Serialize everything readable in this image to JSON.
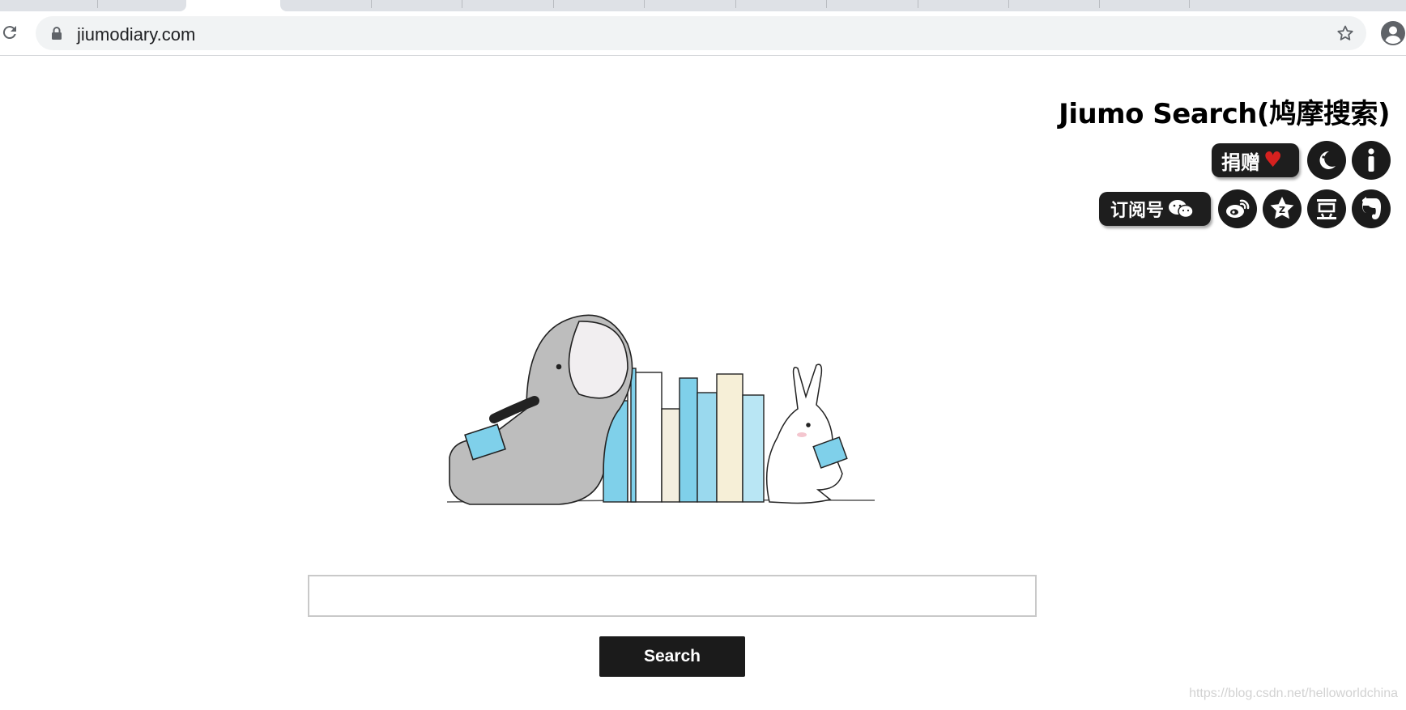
{
  "browser": {
    "url": "jiumodiary.com"
  },
  "header": {
    "brand": "Jiumo Search(鸠摩搜索)",
    "donate_label": "捐赠",
    "subscribe_label": "订阅号",
    "icons": [
      "moon-icon",
      "info-icon",
      "weibo-icon",
      "zhihu-star-icon",
      "douban-icon",
      "evernote-icon"
    ]
  },
  "search": {
    "placeholder": "",
    "value": "",
    "button_label": "Search"
  },
  "watermark": "https://blog.csdn.net/helloworldchina",
  "colors": {
    "accent": "#1b1b1b",
    "heart": "#d6211f",
    "book_blue": "#7fd0ea"
  }
}
